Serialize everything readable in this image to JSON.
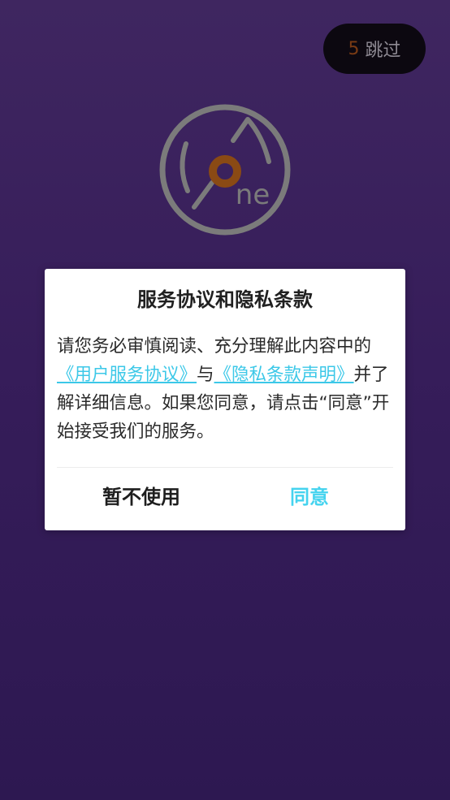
{
  "splash": {
    "skip_count": "5",
    "skip_label": "跳过"
  },
  "dialog": {
    "title": "服务协议和隐私条款",
    "body_intro": "请您务必审慎阅读、充分理解此内容中的",
    "user_agreement_link": "《用户服务协议》",
    "connector": "与",
    "privacy_link": "《隐私条款声明》",
    "body_rest": "并了解详细信息。如果您同意，请点击“同意”开始接受我们的服务。",
    "decline_label": "暂不使用",
    "agree_label": "同意"
  },
  "colors": {
    "link": "#3cc8e8",
    "agree": "#45d3ef",
    "background_top": "#3f2660",
    "background_bottom": "#2d1851"
  },
  "logo": {
    "icon": "one-logo-icon"
  }
}
